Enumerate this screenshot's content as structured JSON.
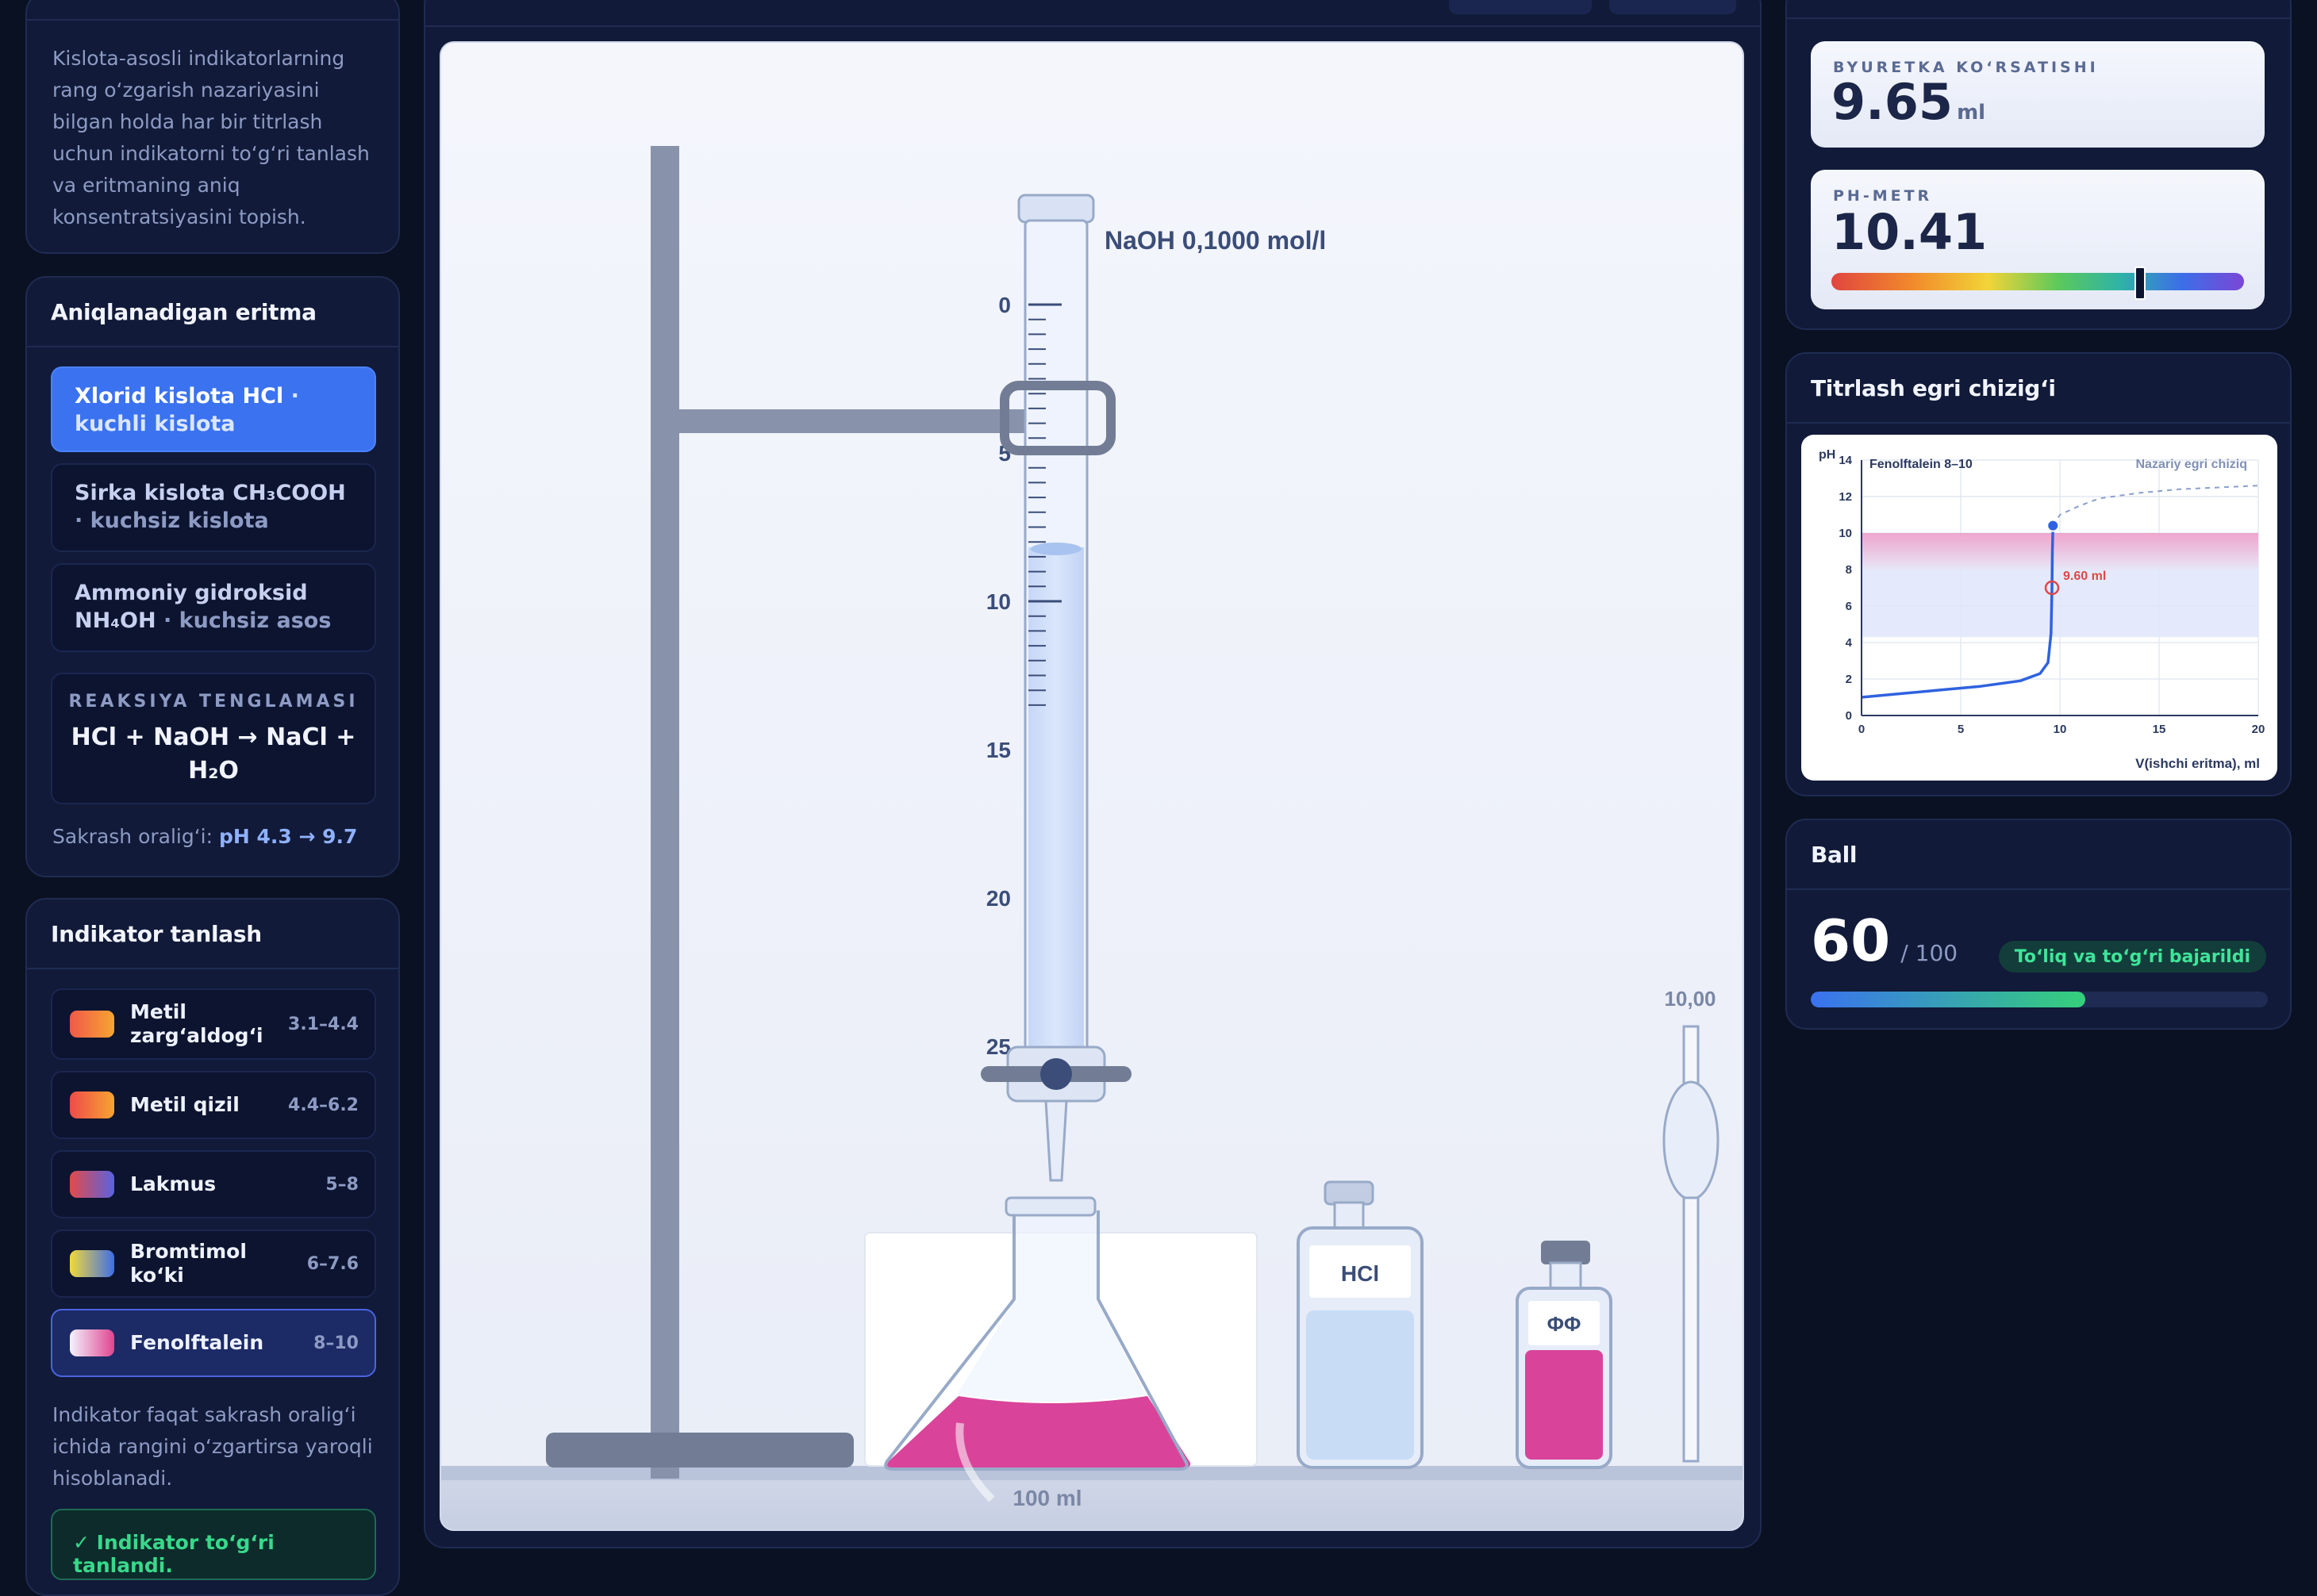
{
  "goal_text": "Kislota-asosli indikatorlarning rang o‘zgarish nazariyasini bilgan holda har bir titrlash uchun indikatorni to‘g‘ri tanlash va eritmaning aniq konsentratsiyasini topish.",
  "solution": {
    "title": "Aniqlanadigan eritma",
    "items": [
      {
        "name": "Xlorid kislota HCl",
        "sub": " · kuchli kislota"
      },
      {
        "name": "Sirka kislota CH₃COOH",
        "sub": " · kuchsiz kislota"
      },
      {
        "name": "Ammoniy gidroksid NH₄OH",
        "sub": " · kuchsiz asos"
      }
    ],
    "reaction_label": "REAKSIYA TENGLAMASI",
    "reaction": "HCl + NaOH → NaCl + H₂O",
    "jump_label": "Sakrash oralig‘i: ",
    "jump_value": "pH 4.3 → 9.7"
  },
  "indicator": {
    "title": "Indikator tanlash",
    "items": [
      {
        "name": "Metil zarg‘aldog‘i",
        "range": "3.1–4.4",
        "swatch": "linear-gradient(90deg,#f0584a,#f7a531)"
      },
      {
        "name": "Metil qizil",
        "range": "4.4–6.2",
        "swatch": "linear-gradient(90deg,#ef4a4a,#f7a531)"
      },
      {
        "name": "Lakmus",
        "range": "5–8",
        "swatch": "linear-gradient(90deg,#e24a4a,#5a62e0)"
      },
      {
        "name": "Bromtimol ko‘ki",
        "range": "6–7.6",
        "swatch": "linear-gradient(90deg,#f2d93a,#3f6ee8)"
      },
      {
        "name": "Fenolftalein",
        "range": "8–10",
        "swatch": "linear-gradient(90deg,#f3f3ff,#e0448f)"
      }
    ],
    "note": "Indikator faqat sakrash oralig‘i ichida rangini o‘zgartirsa yaroqli hisoblanadi.",
    "success": "✓ Indikator to‘g‘ri tanlandi."
  },
  "lab": {
    "titrant_label": "NaOH 0,1000 mol/l",
    "burette_ticks": [
      "0",
      "5",
      "10",
      "15",
      "20",
      "25"
    ],
    "liquid_level_ml": 9.65,
    "flask_volume": "100 ml",
    "hcl_bottle": "HCl",
    "indicator_bottle": "ΦΦ",
    "pipette_label": "10,00"
  },
  "readouts": {
    "burette_label": "BYURETKA KO‘RSATISHI",
    "burette_value": "9.65",
    "burette_unit": "ml",
    "ph_label": "PH-METR",
    "ph_value": "10.41",
    "ph_fraction": 0.744
  },
  "curve": {
    "title": "Titrlash egri chizig‘i",
    "indicator_name": "Fenolftalein 8–10",
    "theory_label": "Nazariy egri chiziq",
    "marker_label": "9.60 ml"
  },
  "chart_data": {
    "type": "line",
    "xlabel": "V(ishchi eritma), ml",
    "ylabel": "pH",
    "xlim": [
      0,
      20
    ],
    "ylim": [
      0,
      14
    ],
    "x_ticks": [
      "0",
      "5",
      "10",
      "15",
      "20"
    ],
    "y_ticks": [
      "0",
      "2",
      "4",
      "6",
      "8",
      "10",
      "12",
      "14"
    ],
    "indicator_band": [
      8,
      10
    ],
    "jump_band": [
      4.3,
      9.7
    ],
    "series": [
      {
        "style": "solid",
        "x": [
          0,
          2,
          4,
          6,
          8,
          9,
          9.4,
          9.55,
          9.6,
          9.62,
          9.65
        ],
        "y": [
          1.0,
          1.2,
          1.4,
          1.6,
          1.9,
          2.3,
          2.9,
          4.5,
          7.0,
          9.0,
          10.41
        ]
      },
      {
        "style": "dashed",
        "x": [
          9.65,
          10,
          11,
          12,
          14,
          16,
          18,
          20
        ],
        "y": [
          10.41,
          11.0,
          11.5,
          11.9,
          12.2,
          12.4,
          12.5,
          12.6
        ]
      }
    ],
    "current_point": {
      "x": 9.65,
      "y": 10.41
    },
    "equivalence_point": {
      "x": 9.6,
      "y": 7.0
    }
  },
  "score": {
    "title": "Ball",
    "value": "60",
    "max": "/ 100",
    "badge": "To‘liq va to‘g‘ri bajarildi",
    "progress_fraction": 0.6
  }
}
